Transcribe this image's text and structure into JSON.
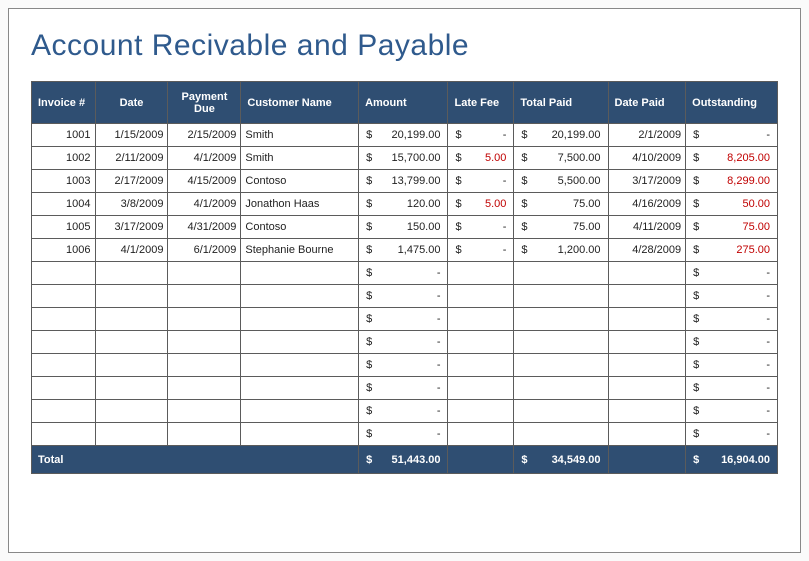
{
  "title": "Account Recivable and Payable",
  "columns": {
    "invoice": "Invoice #",
    "date": "Date",
    "payment_due": "Payment Due",
    "customer_name": "Customer Name",
    "amount": "Amount",
    "late_fee": "Late Fee",
    "total_paid": "Total Paid",
    "date_paid": "Date Paid",
    "outstanding": "Outstanding"
  },
  "currency_symbol": "$",
  "dash": "-",
  "rows": [
    {
      "invoice": "1001",
      "date": "1/15/2009",
      "payment_due": "2/15/2009",
      "customer": "Smith",
      "amount": "20,199.00",
      "late_fee": "-",
      "total_paid": "20,199.00",
      "date_paid": "2/1/2009",
      "outstanding": "-",
      "out_red": false
    },
    {
      "invoice": "1002",
      "date": "2/11/2009",
      "payment_due": "4/1/2009",
      "customer": "Smith",
      "amount": "15,700.00",
      "late_fee": "5.00",
      "total_paid": "7,500.00",
      "date_paid": "4/10/2009",
      "outstanding": "8,205.00",
      "out_red": true
    },
    {
      "invoice": "1003",
      "date": "2/17/2009",
      "payment_due": "4/15/2009",
      "customer": "Contoso",
      "amount": "13,799.00",
      "late_fee": "-",
      "total_paid": "5,500.00",
      "date_paid": "3/17/2009",
      "outstanding": "8,299.00",
      "out_red": true
    },
    {
      "invoice": "1004",
      "date": "3/8/2009",
      "payment_due": "4/1/2009",
      "customer": "Jonathon Haas",
      "amount": "120.00",
      "late_fee": "5.00",
      "total_paid": "75.00",
      "date_paid": "4/16/2009",
      "outstanding": "50.00",
      "out_red": true
    },
    {
      "invoice": "1005",
      "date": "3/17/2009",
      "payment_due": "4/31/2009",
      "customer": "Contoso",
      "amount": "150.00",
      "late_fee": "-",
      "total_paid": "75.00",
      "date_paid": "4/11/2009",
      "outstanding": "75.00",
      "out_red": true
    },
    {
      "invoice": "1006",
      "date": "4/1/2009",
      "payment_due": "6/1/2009",
      "customer": "Stephanie Bourne",
      "amount": "1,475.00",
      "late_fee": "-",
      "total_paid": "1,200.00",
      "date_paid": "4/28/2009",
      "outstanding": "275.00",
      "out_red": true
    }
  ],
  "empty_row_count": 8,
  "totals": {
    "label": "Total",
    "amount": "51,443.00",
    "total_paid": "34,549.00",
    "outstanding": "16,904.00"
  },
  "chart_data": {
    "type": "table",
    "title": "Account Recivable and Payable",
    "columns": [
      "Invoice #",
      "Date",
      "Payment Due",
      "Customer Name",
      "Amount",
      "Late Fee",
      "Total Paid",
      "Date Paid",
      "Outstanding"
    ],
    "rows": [
      [
        1001,
        "1/15/2009",
        "2/15/2009",
        "Smith",
        20199.0,
        null,
        20199.0,
        "2/1/2009",
        null
      ],
      [
        1002,
        "2/11/2009",
        "4/1/2009",
        "Smith",
        15700.0,
        5.0,
        7500.0,
        "4/10/2009",
        8205.0
      ],
      [
        1003,
        "2/17/2009",
        "4/15/2009",
        "Contoso",
        13799.0,
        null,
        5500.0,
        "3/17/2009",
        8299.0
      ],
      [
        1004,
        "3/8/2009",
        "4/1/2009",
        "Jonathon Haas",
        120.0,
        5.0,
        75.0,
        "4/16/2009",
        50.0
      ],
      [
        1005,
        "3/17/2009",
        "4/31/2009",
        "Contoso",
        150.0,
        null,
        75.0,
        "4/11/2009",
        75.0
      ],
      [
        1006,
        "4/1/2009",
        "6/1/2009",
        "Stephanie Bourne",
        1475.0,
        null,
        1200.0,
        "4/28/2009",
        275.0
      ]
    ],
    "totals": {
      "Amount": 51443.0,
      "Total Paid": 34549.0,
      "Outstanding": 16904.0
    }
  }
}
